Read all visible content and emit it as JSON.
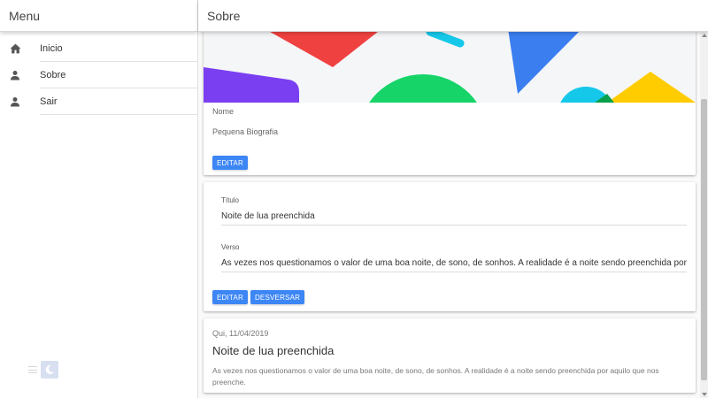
{
  "sidebar": {
    "title": "Menu",
    "items": [
      {
        "label": "Inicio",
        "icon": "home-icon"
      },
      {
        "label": "Sobre",
        "icon": "person-icon"
      },
      {
        "label": "Sair",
        "icon": "person-icon"
      }
    ]
  },
  "topbar": {
    "title": "Sobre"
  },
  "profile": {
    "name_label": "Nome",
    "bio_label": "Pequena Biografia",
    "edit_label": "EDITAR"
  },
  "form": {
    "title_label": "Título",
    "title_value": "Noite de lua preenchida",
    "verse_label": "Verso",
    "verse_value": "As vezes nos questionamos o valor de uma boa noite, de sono, de sonhos. A realidade é a noite sendo preenchida por",
    "edit_label": "EDITAR",
    "dismiss_label": "DESVERSAR"
  },
  "post": {
    "date": "Qui, 11/04/2019",
    "title": "Noite de lua preenchida",
    "text": "As vezes nos questionamos o valor de uma boa noite, de sono, de sonhos. A realidade é a noite sendo preenchida por aquilo que nos preenche."
  },
  "colors": {
    "accent": "#3d86f5",
    "banner_red": "#f04141",
    "banner_cyan": "#15c8ea",
    "banner_blue": "#3a7ef0",
    "banner_green": "#16d468",
    "banner_purple": "#7b3ff2",
    "banner_yellow": "#ffcc00"
  }
}
